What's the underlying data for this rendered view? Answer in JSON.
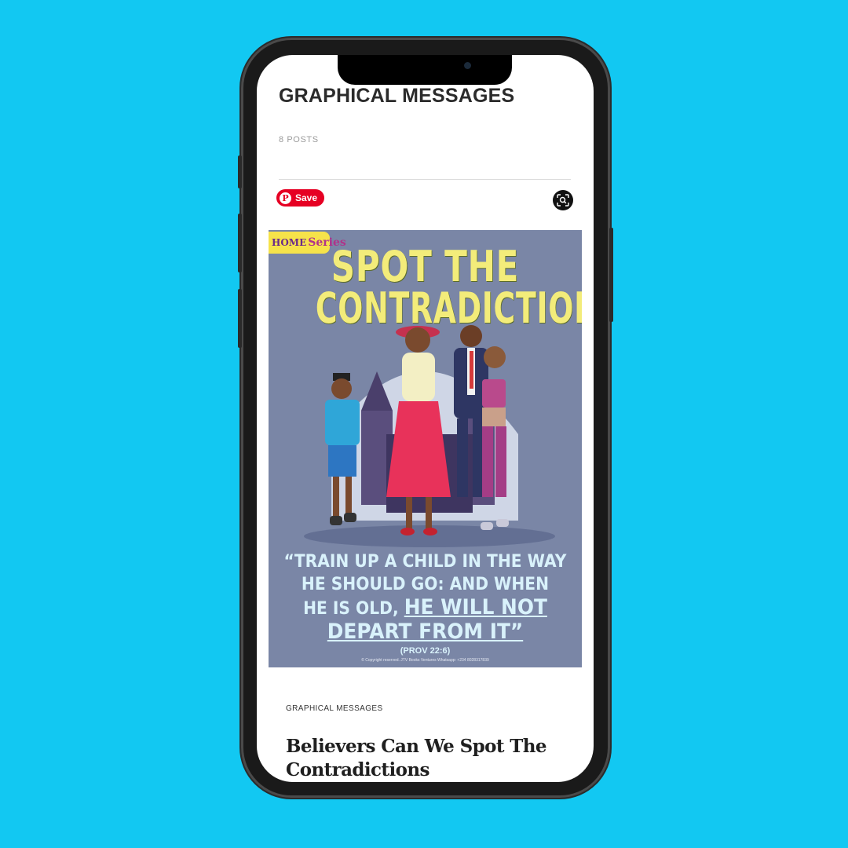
{
  "page": {
    "title": "GRAPHICAL MESSAGES",
    "post_count": "8 POSTS"
  },
  "pin_actions": {
    "save_label": "Save",
    "visual_search_icon": "lens-search-icon"
  },
  "poster": {
    "series_tag_top": "HOME",
    "series_tag": "Series",
    "title_line1": "SPOT THE",
    "title_line2": "CONTRADICTIONS",
    "quote_line1": "“TRAIN UP A CHILD IN THE WAY",
    "quote_line2": "HE SHOULD GO: AND WHEN",
    "quote_line3a": "HE IS OLD, ",
    "quote_line3b": "HE WILL NOT",
    "quote_line4": "DEPART FROM IT”",
    "reference": "(PROV 22:6)",
    "copyright": "© Copyright reserved. JTV Books Ventures Whatsapp: +234 8028317839"
  },
  "post": {
    "category": "GRAPHICAL MESSAGES",
    "title": "Believers Can We Spot The Contradictions"
  },
  "colors": {
    "background": "#12c8f2",
    "save_button": "#e60023",
    "poster_bg": "#7a86a6",
    "poster_title": "#f3ec7a"
  }
}
